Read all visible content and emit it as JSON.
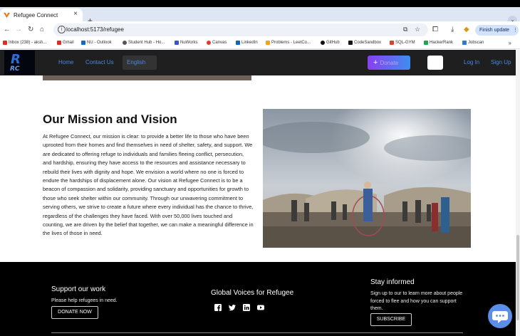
{
  "browser": {
    "tab_title": "Refugee Connect",
    "url": "localhost:5173/refugee",
    "finish_update_label": "Finish update",
    "bookmarks": [
      {
        "label": "Inbox (238) - aksh..."
      },
      {
        "label": "Gmail"
      },
      {
        "label": "NU - Outlook"
      },
      {
        "label": "Student Hub - Ho..."
      },
      {
        "label": "NuWorks"
      },
      {
        "label": "Canvas"
      },
      {
        "label": "LinkedIn"
      },
      {
        "label": "Problems - LeetCo..."
      },
      {
        "label": "GitHub"
      },
      {
        "label": "CodeSandbox"
      },
      {
        "label": "SQL-GYM"
      },
      {
        "label": "HackerRank"
      },
      {
        "label": "Jobscan"
      }
    ]
  },
  "site_nav": {
    "logo_mark": "R",
    "logo_sub": "RC",
    "links": [
      "Home",
      "Contact Us"
    ],
    "language": "English",
    "donate_label": "Donate",
    "login_label": "Log In",
    "signup_label": "Sign Up"
  },
  "mission": {
    "title": "Our Mission and Vision",
    "body": "At Refugee Connect, our mission is clear: to provide a better life to those who have been uprooted from their homes and find themselves in need of shelter, safety, and support. We are dedicated to offering refuge to individuals and families fleeing conflict, persecution, and hardship, ensuring they have access to the resources and assistance necessary to rebuild their lives with dignity and hope. We envision a world where no one is forced to endure the hardships of displacement alone. Our vision at Refugee Connect is to be a beacon of compassion and solidarity, providing sanctuary and opportunities for growth to those who seek shelter within our community. Through our unwavering commitment to serving others, we strive to create a future where every individual has the chance to thrive, regardless of the challenges they have faced. With over 50,000 lives touched and counting, we are driven by the belief that together, we can make a meaningful difference in the lives of those in need."
  },
  "footer": {
    "support_heading": "Support our work",
    "support_text": "Please help refugees in need.",
    "donate_now_label": "DONATE NOW",
    "voices_heading": "Global Voices for Refugee",
    "social_icons": [
      "facebook-icon",
      "twitter-icon",
      "linkedin-icon",
      "youtube-icon"
    ],
    "informed_heading": "Stay informed",
    "informed_text": "Sign up to our to learn more about people forced to flee and how you can support them.",
    "subscribe_label": "SUBSCRIBE"
  },
  "colors": {
    "nav_bg": "#1f1f1f",
    "nav_link": "#4a88e8",
    "donate_gradient_start": "#8a3ff0",
    "donate_gradient_end": "#3d8ef0",
    "footer_bg": "#000000",
    "chat_fab": "#5b8ee8"
  }
}
